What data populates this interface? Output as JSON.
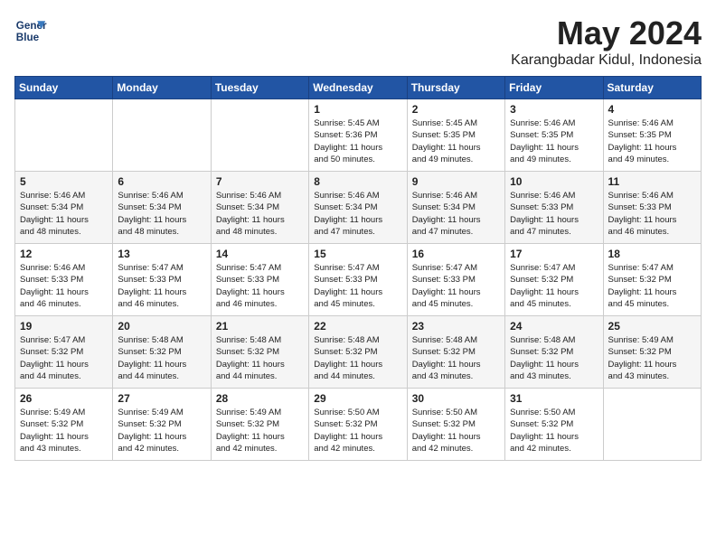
{
  "header": {
    "logo_line1": "General",
    "logo_line2": "Blue",
    "month": "May 2024",
    "location": "Karangbadar Kidul, Indonesia"
  },
  "weekdays": [
    "Sunday",
    "Monday",
    "Tuesday",
    "Wednesday",
    "Thursday",
    "Friday",
    "Saturday"
  ],
  "weeks": [
    [
      {
        "day": "",
        "info": ""
      },
      {
        "day": "",
        "info": ""
      },
      {
        "day": "",
        "info": ""
      },
      {
        "day": "1",
        "info": "Sunrise: 5:45 AM\nSunset: 5:36 PM\nDaylight: 11 hours\nand 50 minutes."
      },
      {
        "day": "2",
        "info": "Sunrise: 5:45 AM\nSunset: 5:35 PM\nDaylight: 11 hours\nand 49 minutes."
      },
      {
        "day": "3",
        "info": "Sunrise: 5:46 AM\nSunset: 5:35 PM\nDaylight: 11 hours\nand 49 minutes."
      },
      {
        "day": "4",
        "info": "Sunrise: 5:46 AM\nSunset: 5:35 PM\nDaylight: 11 hours\nand 49 minutes."
      }
    ],
    [
      {
        "day": "5",
        "info": "Sunrise: 5:46 AM\nSunset: 5:34 PM\nDaylight: 11 hours\nand 48 minutes."
      },
      {
        "day": "6",
        "info": "Sunrise: 5:46 AM\nSunset: 5:34 PM\nDaylight: 11 hours\nand 48 minutes."
      },
      {
        "day": "7",
        "info": "Sunrise: 5:46 AM\nSunset: 5:34 PM\nDaylight: 11 hours\nand 48 minutes."
      },
      {
        "day": "8",
        "info": "Sunrise: 5:46 AM\nSunset: 5:34 PM\nDaylight: 11 hours\nand 47 minutes."
      },
      {
        "day": "9",
        "info": "Sunrise: 5:46 AM\nSunset: 5:34 PM\nDaylight: 11 hours\nand 47 minutes."
      },
      {
        "day": "10",
        "info": "Sunrise: 5:46 AM\nSunset: 5:33 PM\nDaylight: 11 hours\nand 47 minutes."
      },
      {
        "day": "11",
        "info": "Sunrise: 5:46 AM\nSunset: 5:33 PM\nDaylight: 11 hours\nand 46 minutes."
      }
    ],
    [
      {
        "day": "12",
        "info": "Sunrise: 5:46 AM\nSunset: 5:33 PM\nDaylight: 11 hours\nand 46 minutes."
      },
      {
        "day": "13",
        "info": "Sunrise: 5:47 AM\nSunset: 5:33 PM\nDaylight: 11 hours\nand 46 minutes."
      },
      {
        "day": "14",
        "info": "Sunrise: 5:47 AM\nSunset: 5:33 PM\nDaylight: 11 hours\nand 46 minutes."
      },
      {
        "day": "15",
        "info": "Sunrise: 5:47 AM\nSunset: 5:33 PM\nDaylight: 11 hours\nand 45 minutes."
      },
      {
        "day": "16",
        "info": "Sunrise: 5:47 AM\nSunset: 5:33 PM\nDaylight: 11 hours\nand 45 minutes."
      },
      {
        "day": "17",
        "info": "Sunrise: 5:47 AM\nSunset: 5:32 PM\nDaylight: 11 hours\nand 45 minutes."
      },
      {
        "day": "18",
        "info": "Sunrise: 5:47 AM\nSunset: 5:32 PM\nDaylight: 11 hours\nand 45 minutes."
      }
    ],
    [
      {
        "day": "19",
        "info": "Sunrise: 5:47 AM\nSunset: 5:32 PM\nDaylight: 11 hours\nand 44 minutes."
      },
      {
        "day": "20",
        "info": "Sunrise: 5:48 AM\nSunset: 5:32 PM\nDaylight: 11 hours\nand 44 minutes."
      },
      {
        "day": "21",
        "info": "Sunrise: 5:48 AM\nSunset: 5:32 PM\nDaylight: 11 hours\nand 44 minutes."
      },
      {
        "day": "22",
        "info": "Sunrise: 5:48 AM\nSunset: 5:32 PM\nDaylight: 11 hours\nand 44 minutes."
      },
      {
        "day": "23",
        "info": "Sunrise: 5:48 AM\nSunset: 5:32 PM\nDaylight: 11 hours\nand 43 minutes."
      },
      {
        "day": "24",
        "info": "Sunrise: 5:48 AM\nSunset: 5:32 PM\nDaylight: 11 hours\nand 43 minutes."
      },
      {
        "day": "25",
        "info": "Sunrise: 5:49 AM\nSunset: 5:32 PM\nDaylight: 11 hours\nand 43 minutes."
      }
    ],
    [
      {
        "day": "26",
        "info": "Sunrise: 5:49 AM\nSunset: 5:32 PM\nDaylight: 11 hours\nand 43 minutes."
      },
      {
        "day": "27",
        "info": "Sunrise: 5:49 AM\nSunset: 5:32 PM\nDaylight: 11 hours\nand 42 minutes."
      },
      {
        "day": "28",
        "info": "Sunrise: 5:49 AM\nSunset: 5:32 PM\nDaylight: 11 hours\nand 42 minutes."
      },
      {
        "day": "29",
        "info": "Sunrise: 5:50 AM\nSunset: 5:32 PM\nDaylight: 11 hours\nand 42 minutes."
      },
      {
        "day": "30",
        "info": "Sunrise: 5:50 AM\nSunset: 5:32 PM\nDaylight: 11 hours\nand 42 minutes."
      },
      {
        "day": "31",
        "info": "Sunrise: 5:50 AM\nSunset: 5:32 PM\nDaylight: 11 hours\nand 42 minutes."
      },
      {
        "day": "",
        "info": ""
      }
    ]
  ]
}
